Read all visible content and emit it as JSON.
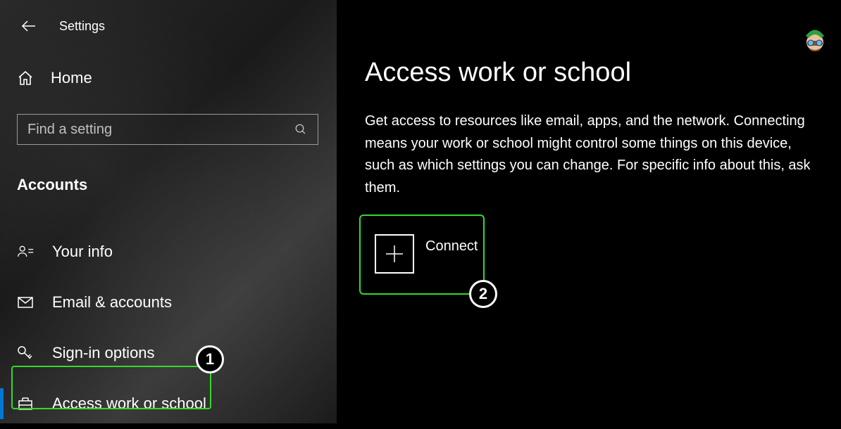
{
  "header": {
    "title": "Settings"
  },
  "sidebar": {
    "home_label": "Home",
    "search_placeholder": "Find a setting",
    "category_label": "Accounts",
    "items": [
      {
        "label": "Your info"
      },
      {
        "label": "Email & accounts"
      },
      {
        "label": "Sign-in options"
      },
      {
        "label": "Access work or school"
      }
    ]
  },
  "main": {
    "title": "Access work or school",
    "description": "Get access to resources like email, apps, and the network. Connecting means your work or school might control some things on this device, such as which settings you can change. For specific info about this, ask them.",
    "connect_label": "Connect"
  },
  "annotations": {
    "badge1": "1",
    "badge2": "2"
  }
}
